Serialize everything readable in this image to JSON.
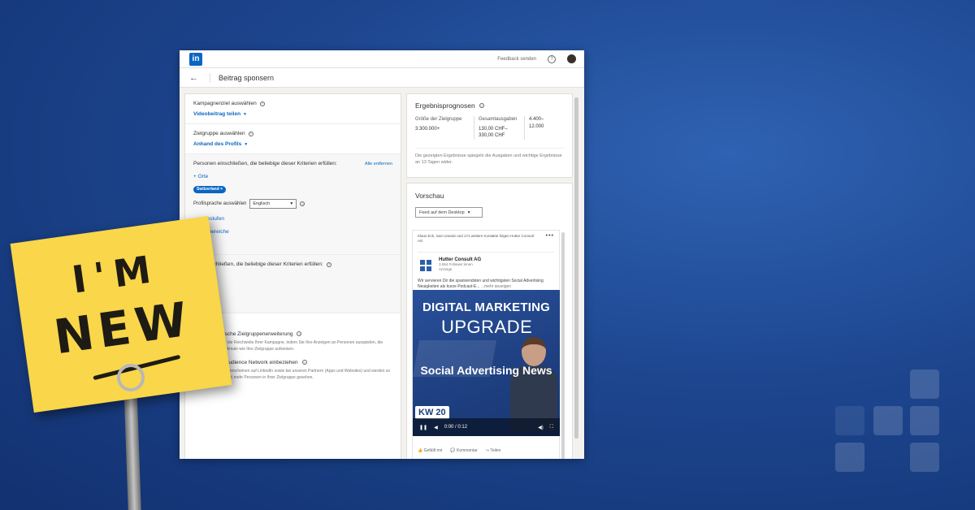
{
  "app": {
    "logo": "in",
    "feedback": "Feedback senden",
    "help": "?",
    "page_title": "Beitrag sponsern",
    "back": "←"
  },
  "campaign": {
    "label": "Kampagnenziel auswählen",
    "value": "Videobeitrag teilen"
  },
  "audience": {
    "label": "Zielgruppe auswählen",
    "value": "Anhand des Profils"
  },
  "include": {
    "label": "Personen einschließen, die beliebige dieser Kriterien erfüllen:",
    "remove_all": "Alle entfernen",
    "locations": "+ Orte",
    "chip": "Switzerland ×",
    "language_label": "Profilsprache auswählen",
    "language_value": "Englisch",
    "criteria": [
      "...merestufen",
      "...keitsbereiche",
      "...chen"
    ]
  },
  "exclude": {
    "label": "...n ausschließen, die beliebige dieser Kriterien erfüllen:",
    "criteria": [
      "...men",
      "...stufen",
      "...sbereiche"
    ]
  },
  "options": {
    "toggle": "...ptionen ^",
    "expansion_label": "Automatische Zielgruppenerweiterung",
    "expansion_desc": "Erhöhen Sie die Reichweite Ihrer Kampagne, indem Sie Ihre Anzeigen an Personen ausspielen, die ähnliche Merkmale wie Ihre Zielgruppe aufweisen.",
    "network_label": "LinkedIn Audience Network einbeziehen",
    "network_desc": "Ihre Anzeigen erscheinen auf LinkedIn sowie bei unseren Partnern (Apps und Websites) und werden so von bis zu 25 % mehr Personen in Ihrer Zielgruppe gesehen."
  },
  "forecast": {
    "title": "Ergebnisprognosen",
    "size_label": "Größe der Zielgruppe",
    "size_value": "3.300.000+",
    "spend_label": "Gesamtausgaben",
    "spend_value": "130,00 CHF– 330,00 CHF",
    "range_value": "4.400– 12.000",
    "note": "Die gezeigten Ergebnisse spiegeln die Ausgaben und wichtige Ergebnisse an 13 Tagen wider."
  },
  "preview": {
    "title": "Vorschau",
    "dropdown": "Feed auf dem Desktop",
    "social": "Klaus Eck, Ivan Urando und 171 weitere Kontakte folgen Hutter Consult AG",
    "company": "Hutter Consult AG",
    "followers": "3.064 Follower:innen",
    "ad": "Anzeige",
    "body": "Wir servieren Dir die spannendsten und wichtigsten Social Advertising Neuigkeiten als kurze Podcast-E...",
    "more": "...mehr anzeigen",
    "video_title1": "DIGITAL MARKETING",
    "video_title2": "UPGRADE",
    "video_title3": "Social Advertising News",
    "kw": "KW 20",
    "time": "0:00 / 0:12",
    "like": "Gefällt mir",
    "comment": "Kommentar",
    "share": "Teilen"
  },
  "sticky_note": {
    "line1": "I'M",
    "line2": "NEW"
  },
  "colors": {
    "brand": "#0a66c2",
    "note": "#f9d64a",
    "background": "#1d468f"
  }
}
